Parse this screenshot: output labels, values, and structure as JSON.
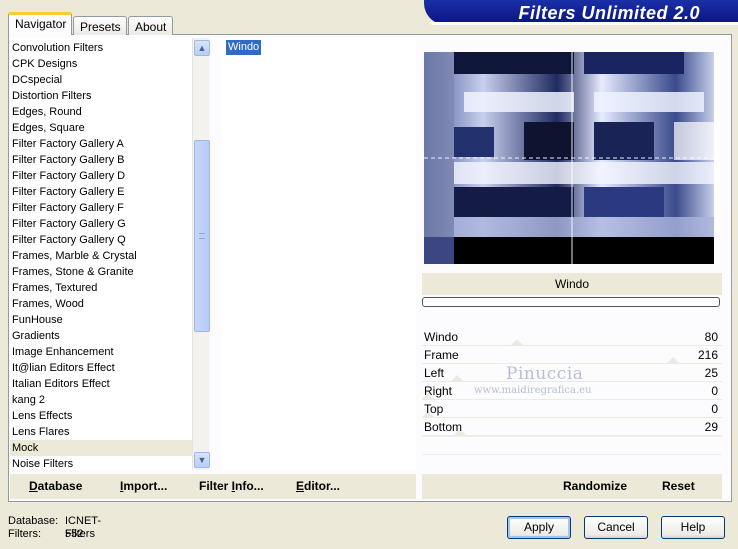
{
  "tabs": [
    {
      "label": "Navigator",
      "active": true
    },
    {
      "label": "Presets",
      "active": false
    },
    {
      "label": "About",
      "active": false
    }
  ],
  "header": {
    "title": "Filters Unlimited 2.0"
  },
  "categories": {
    "items": [
      "Convolution Filters",
      "CPK Designs",
      "DCspecial",
      "Distortion Filters",
      "Edges, Round",
      "Edges, Square",
      "Filter Factory Gallery A",
      "Filter Factory Gallery B",
      "Filter Factory Gallery D",
      "Filter Factory Gallery E",
      "Filter Factory Gallery F",
      "Filter Factory Gallery G",
      "Filter Factory Gallery Q",
      "Frames, Marble & Crystal",
      "Frames, Stone & Granite",
      "Frames, Textured",
      "Frames, Wood",
      "FunHouse",
      "Gradients",
      "Image Enhancement",
      "It@lian Editors Effect",
      "Italian Editors Effect",
      "kang 2",
      "Lens Effects",
      "Lens Flares",
      "Mock",
      "Noise Filters"
    ],
    "selected": "Mock"
  },
  "filters": {
    "items": [
      "Windo"
    ],
    "selected": "Windo"
  },
  "preview": {
    "filter_name": "Windo"
  },
  "params": [
    {
      "label": "Windo",
      "value": "80",
      "fraction": 0.31
    },
    {
      "label": "Frame",
      "value": "216",
      "fraction": 0.85
    },
    {
      "label": "Left",
      "value": "25",
      "fraction": 0.1
    },
    {
      "label": "Right",
      "value": "0",
      "fraction": 0.0
    },
    {
      "label": "Top",
      "value": "0",
      "fraction": 0.0
    },
    {
      "label": "Bottom",
      "value": "29",
      "fraction": 0.11
    }
  ],
  "watermark": {
    "name": "Pinuccia",
    "url": "www.maidiregrafica.eu"
  },
  "toolbar": {
    "database_u": "D",
    "database_rest": "atabase",
    "import_u": "I",
    "import_rest": "mport...",
    "filterinfo_pre": "Filter ",
    "filterinfo_u": "I",
    "filterinfo_rest": "nfo...",
    "editor_u": "E",
    "editor_rest": "ditor...",
    "randomize": "Randomize",
    "reset": "Reset"
  },
  "status": {
    "database_label": "Database:",
    "database_value": "ICNET-Filters",
    "filters_label": "Filters:",
    "filters_value": "552"
  },
  "buttons": {
    "apply": "Apply",
    "cancel": "Cancel",
    "help": "Help"
  },
  "colors": {
    "accent": "#316ac5",
    "banner": "#0a1380",
    "tab_highlight": "#ffc83c"
  }
}
